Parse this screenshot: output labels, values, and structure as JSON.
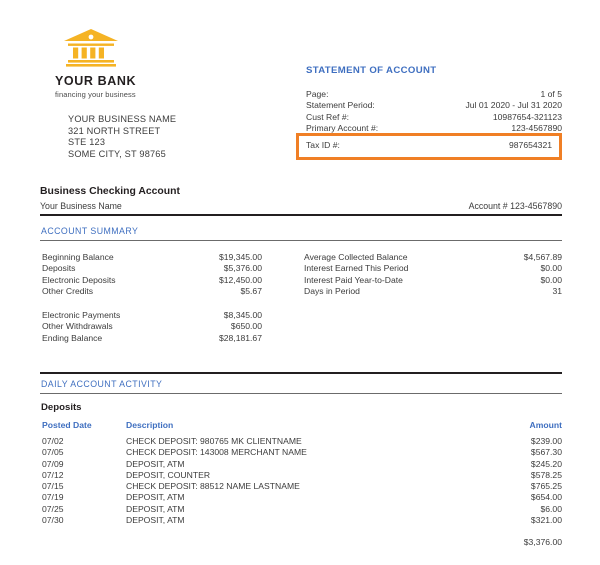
{
  "brand": {
    "logo_icon": "bank-building-icon",
    "name": "YOUR BANK",
    "tagline": "financing your business",
    "logo_color": "#f5b324",
    "accent_blue": "#3f6fc0",
    "callout_orange": "#f07f25"
  },
  "recipient": {
    "line1": "YOUR BUSINESS NAME",
    "line2": "321 NORTH STREET",
    "line3": "STE 123",
    "line4": "SOME CITY, ST 98765"
  },
  "statement": {
    "title": "STATEMENT OF ACCOUNT",
    "rows": [
      {
        "label": "Page:",
        "value": "1 of 5"
      },
      {
        "label": "Statement Period:",
        "value": "Jul 01 2020 - Jul 31 2020"
      },
      {
        "label": "Cust Ref #:",
        "value": "10987654-321123"
      },
      {
        "label": "Primary Account #:",
        "value": "123-4567890"
      }
    ],
    "highlighted_row": {
      "label": "Tax ID #:",
      "value": "987654321"
    }
  },
  "account": {
    "title": "Business Checking Account",
    "subtitle": "Your Business Name",
    "number_label": "Account # 123-4567890"
  },
  "summary": {
    "heading": "ACCOUNT SUMMARY",
    "left_top": [
      {
        "label": "Beginning Balance",
        "value": "$19,345.00"
      },
      {
        "label": "Deposits",
        "value": "$5,376.00"
      },
      {
        "label": "Electronic Deposits",
        "value": "$12,450.00"
      },
      {
        "label": "Other Credits",
        "value": "$5.67"
      }
    ],
    "left_bottom": [
      {
        "label": "Electronic Payments",
        "value": "$8,345.00"
      },
      {
        "label": "Other Withdrawals",
        "value": "$650.00"
      },
      {
        "label": "Ending Balance",
        "value": "$28,181.67"
      }
    ],
    "right": [
      {
        "label": "Average Collected Balance",
        "value": "$4,567.89"
      },
      {
        "label": "Interest Earned This Period",
        "value": "$0.00"
      },
      {
        "label": "Interest Paid Year-to-Date",
        "value": "$0.00"
      },
      {
        "label": "Days in Period",
        "value": "31"
      }
    ]
  },
  "activity": {
    "heading": "DAILY ACCOUNT ACTIVITY",
    "deposits_title": "Deposits",
    "columns": {
      "date": "Posted Date",
      "description": "Description",
      "amount": "Amount"
    },
    "rows": [
      {
        "date": "07/02",
        "description": "CHECK DEPOSIT: 980765 MK CLIENTNAME",
        "amount": "$239.00"
      },
      {
        "date": "07/05",
        "description": "CHECK DEPOSIT: 143008 MERCHANT NAME",
        "amount": "$567.30"
      },
      {
        "date": "07/09",
        "description": "DEPOSIT, ATM",
        "amount": "$245.20"
      },
      {
        "date": "07/12",
        "description": "DEPOSIT, COUNTER",
        "amount": "$578.25"
      },
      {
        "date": "07/15",
        "description": "CHECK DEPOSIT: 88512 NAME LASTNAME",
        "amount": "$765.25"
      },
      {
        "date": "07/19",
        "description": "DEPOSIT, ATM",
        "amount": "$654.00"
      },
      {
        "date": "07/25",
        "description": "DEPOSIT, ATM",
        "amount": "$6.00"
      },
      {
        "date": "07/30",
        "description": "DEPOSIT, ATM",
        "amount": "$321.00"
      }
    ],
    "total": "$3,376.00"
  }
}
